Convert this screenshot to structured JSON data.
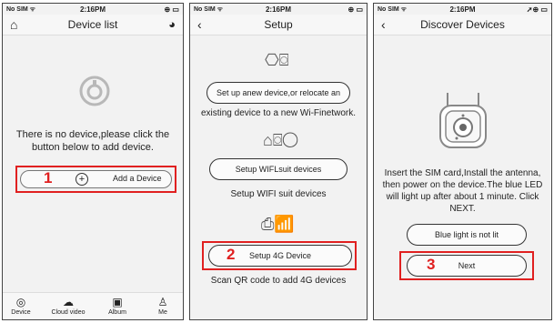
{
  "status": {
    "carrier": "No SIM",
    "time": "2:16PM"
  },
  "screen1": {
    "title": "Device list",
    "empty_message": "There is no device,please click the button below to add device.",
    "step_number": "1",
    "add_button_label": "Add a Device",
    "tabs": [
      {
        "label": "Device",
        "icon": "camera-icon"
      },
      {
        "label": "Cloud video",
        "icon": "cloud-icon"
      },
      {
        "label": "Album",
        "icon": "image-icon"
      },
      {
        "label": "Me",
        "icon": "person-icon"
      }
    ]
  },
  "screen2": {
    "title": "Setup",
    "option1_button": "Set up anew device,or relocate an",
    "option1_text": "existing device to a new Wi-Finetwork.",
    "option2_button": "Setup WIFLsuit devices",
    "option2_text": "Setup WIFI suit devices",
    "step_number": "2",
    "option3_button": "Setup 4G Device",
    "option3_text": "Scan QR code to add 4G devices"
  },
  "screen3": {
    "title": "Discover Devices",
    "instructions": "Insert the SIM card,Install the antenna, then power on the device.The blue LED will light up after about 1 minute. Click NEXT.",
    "blue_light_button": "Blue light is not lit",
    "step_number": "3",
    "next_button": "Next"
  },
  "colors": {
    "highlight": "#e02020"
  }
}
